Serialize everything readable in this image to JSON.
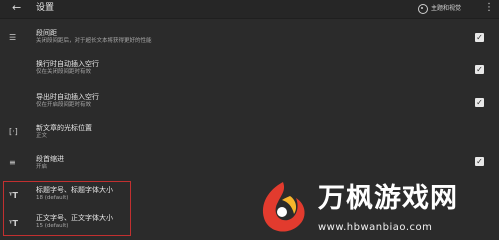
{
  "header": {
    "back_icon": "arrow-left-icon",
    "title": "设置",
    "theme_button_label": "主题和视觉",
    "more_icon": "more-vertical-icon"
  },
  "settings": [
    {
      "icon": "paragraph-spacing-icon",
      "title": "段间距",
      "subtitle": "关闭段间距后，对于超长文本将获得更好的性能",
      "checked": true
    },
    {
      "icon": "",
      "title": "换行时自动插入空行",
      "subtitle": "仅在关闭段间距时有效",
      "checked": true
    },
    {
      "icon": "",
      "title": "导出时自动插入空行",
      "subtitle": "仅在开启段间距时有效",
      "checked": true
    },
    {
      "icon": "cursor-focus-icon",
      "title": "新文章的光标位置",
      "subtitle": "正文",
      "checked": null
    },
    {
      "icon": "indent-icon",
      "title": "段首缩进",
      "subtitle": "开启",
      "checked": true
    },
    {
      "icon": "font-size-icon",
      "title": "标题字号、标题字体大小",
      "subtitle": "18 (default)",
      "checked": null
    },
    {
      "icon": "font-size-icon",
      "title": "正文字号、正文字体大小",
      "subtitle": "15 (default)",
      "checked": null
    }
  ],
  "watermark": {
    "title": "万枫游戏网",
    "url": "www.hbwanbiao.com"
  },
  "colors": {
    "background": "#2b2b2b",
    "highlight": "#c23030",
    "checkbox": "#e8e8e8"
  }
}
